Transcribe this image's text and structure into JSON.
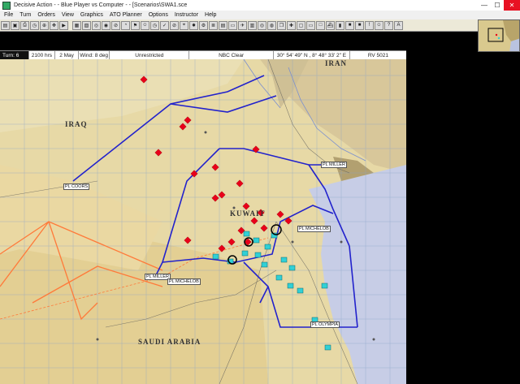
{
  "window": {
    "title": "Decisive Action - - Blue Player vs Computer - - [Scenarios\\SWA1.sce",
    "minimize": "—",
    "maximize": "☐",
    "close": "✕"
  },
  "menu": [
    "File",
    "Turn",
    "Orders",
    "View",
    "Graphics",
    "ATO Planner",
    "Options",
    "Instructor",
    "Help"
  ],
  "toolbar_icons": [
    "open-icon",
    "save-icon",
    "print-icon",
    "clock-icon",
    "zoom-icon",
    "move-icon",
    "video-icon",
    "separator",
    "grid-icon",
    "map-icon",
    "ring-icon",
    "target-icon",
    "no-entry-icon",
    "timer-icon",
    "flag-icon",
    "person-icon",
    "clock-2-icon",
    "mark-icon",
    "no-entry-2-icon",
    "crosshair-icon",
    "bomb-icon",
    "gear-icon",
    "list-icon",
    "report-icon",
    "tank-icon",
    "plane-icon",
    "chart-icon",
    "ring-2-icon",
    "globe-icon",
    "layers-icon",
    "cross-icon",
    "box-icon",
    "rect-icon",
    "blank-icon",
    "ship-icon",
    "bar-icon",
    "purple-icon",
    "red-icon",
    "alert-icon",
    "person-2-icon",
    "help-icon",
    "text-icon"
  ],
  "status": {
    "turn": "Turn: 6",
    "time": "2100 hrs",
    "date": "2 May",
    "wind": "Wind: 8 deg",
    "visibility": "Unrestricted",
    "nbc": "NBC Clear",
    "coords": "30° 54' 49\" N , 8° 48° 33' 2\" E",
    "grid": "RV 5021"
  },
  "map": {
    "countries": [
      "IRAQ",
      "IRAN",
      "KUWAIT",
      "SAUDI ARABIA"
    ],
    "phase_lines": [
      "PL COORS",
      "PL MILLER",
      "PL MICHELOB",
      "PL MILLER",
      "PL MICHELOB",
      "PL OLYMPIA"
    ],
    "colors": {
      "phase_line": "#2222cc",
      "border": "#ff7a3a",
      "enemy": "#e8001a",
      "friendly": "#31d0d6",
      "desert": "#e7d9a6",
      "gulf": "#c7cde6"
    }
  }
}
